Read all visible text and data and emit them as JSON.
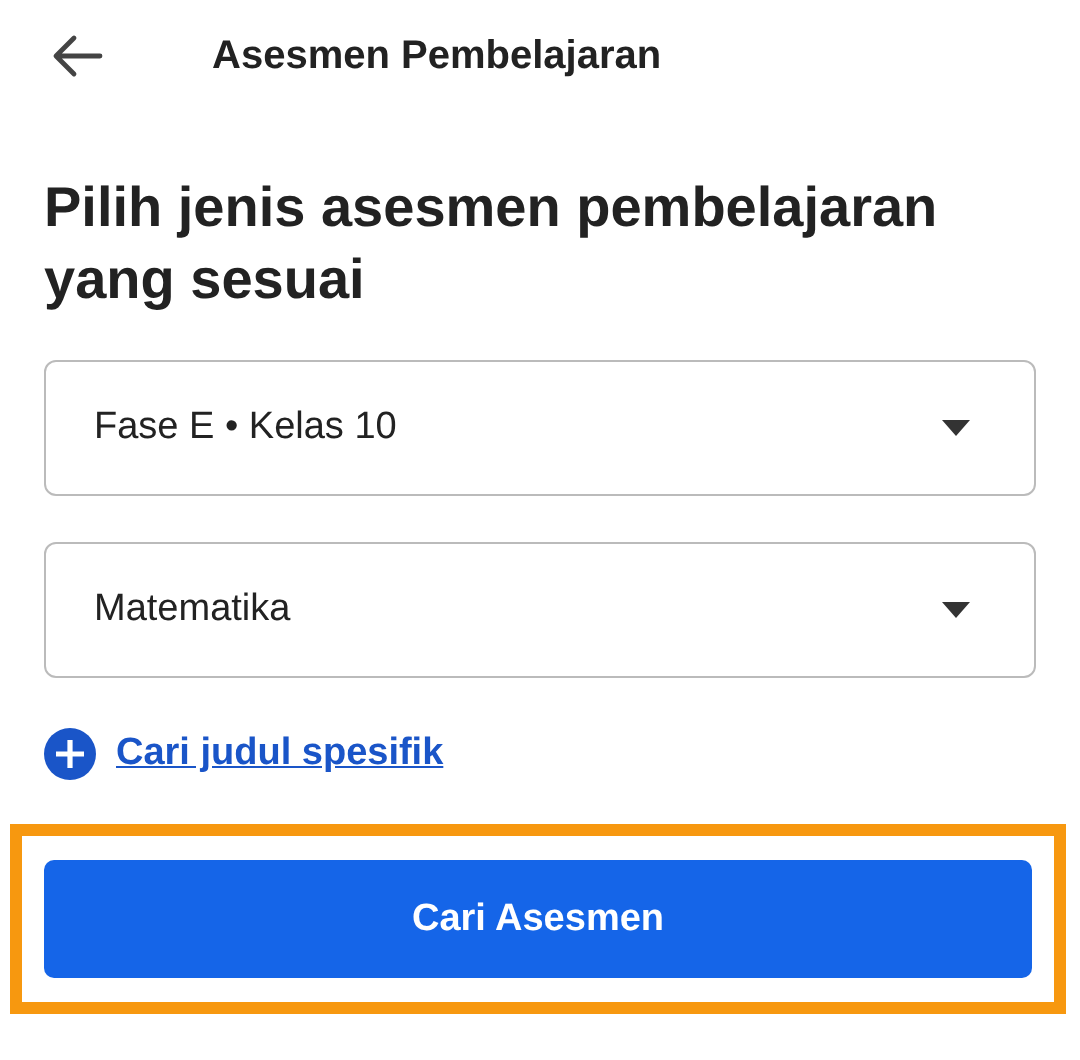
{
  "header": {
    "title": "Asesmen Pembelajaran"
  },
  "heading": "Pilih jenis asesmen pembelajaran yang sesuai",
  "dropdowns": [
    {
      "value": "Fase E • Kelas 10"
    },
    {
      "value": "Matematika"
    }
  ],
  "link": {
    "label": "Cari judul spesifik"
  },
  "button": {
    "label": "Cari Asesmen",
    "highlighted": true
  }
}
